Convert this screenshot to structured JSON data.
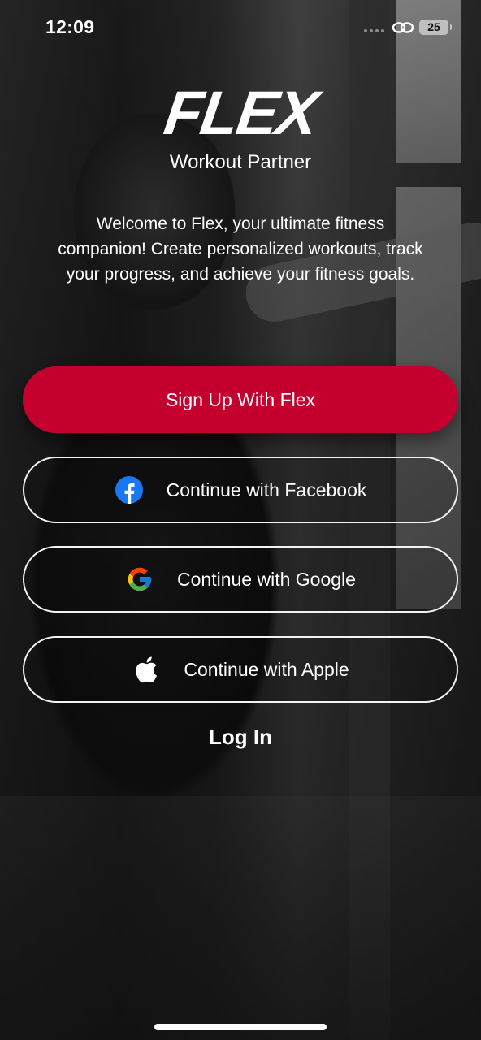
{
  "status_bar": {
    "time": "12:09",
    "battery": "25",
    "icons": [
      "signal-dots-icon",
      "link-icon",
      "battery-icon"
    ]
  },
  "header": {
    "logo": "FLEX",
    "tagline": "Workout Partner",
    "welcome": "Welcome to Flex, your ultimate fitness companion! Create personalized workouts, track your progress, and achieve your fitness goals."
  },
  "buttons": {
    "signup": "Sign Up With Flex",
    "facebook": "Continue with Facebook",
    "google": "Continue with Google",
    "apple": "Continue with Apple",
    "login": "Log In"
  },
  "colors": {
    "primary": "#c4002f",
    "facebook": "#1877f2",
    "text": "#ffffff"
  }
}
